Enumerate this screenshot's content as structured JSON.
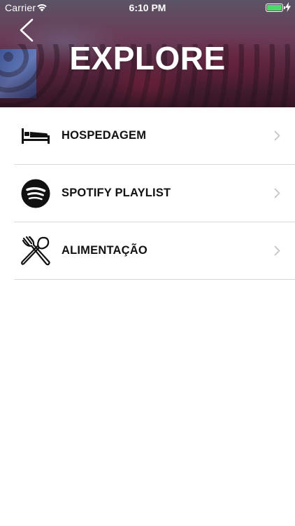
{
  "status_bar": {
    "carrier": "Carrier",
    "time": "6:10 PM",
    "battery_color": "#4cd964"
  },
  "header": {
    "title": "EXPLORE",
    "back_icon": "chevron-left-icon"
  },
  "menu": {
    "items": [
      {
        "label": "HOSPEDAGEM",
        "icon": "bed-icon"
      },
      {
        "label": "SPOTIFY PLAYLIST",
        "icon": "spotify-icon"
      },
      {
        "label": "ALIMENTAÇÃO",
        "icon": "fork-spoon-icon"
      }
    ],
    "chevron_icon": "chevron-right-icon"
  }
}
